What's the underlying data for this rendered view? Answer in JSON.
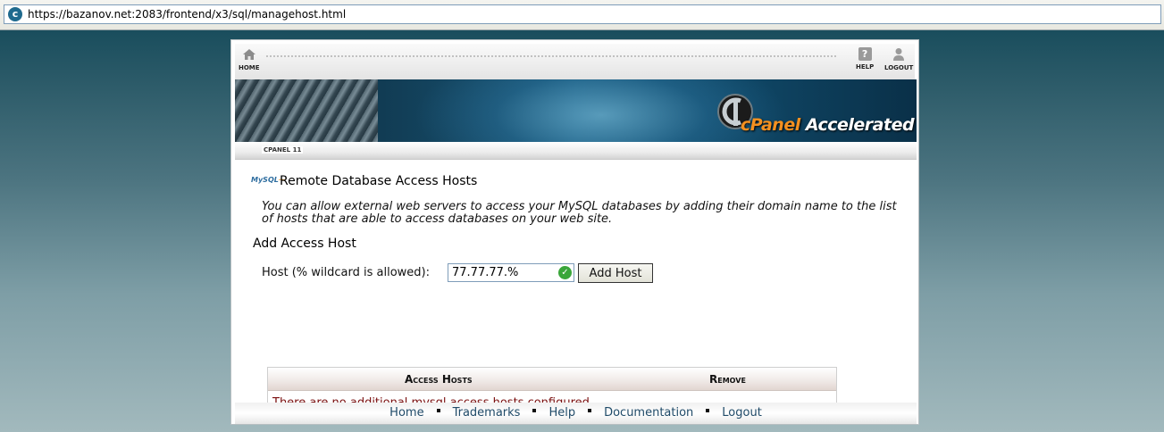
{
  "browser": {
    "url": "https://bazanov.net:2083/frontend/x3/sql/managehost.html"
  },
  "toolbar": {
    "home_label": "HOME",
    "help_label": "HELP",
    "logout_label": "LOGOUT"
  },
  "banner": {
    "brand_primary": "cPanel",
    "brand_secondary": "Accelerated"
  },
  "version_label": "CPANEL 11",
  "page": {
    "icon_text": "MySQL",
    "title": "Remote Database Access Hosts",
    "description": "You can allow external web servers to access your MySQL databases by adding their domain name to the list of hosts that are able to access databases on your web site.",
    "add_section_title": "Add Access Host",
    "host_label": "Host (% wildcard is allowed):",
    "host_value": "77.77.77.%",
    "add_button": "Add Host"
  },
  "hosts_table": {
    "columns": [
      "Access Hosts",
      "Remove"
    ],
    "rows": [],
    "empty_message": "There are no additional mysql access hosts configured"
  },
  "footer": {
    "links": [
      "Home",
      "Trademarks",
      "Help",
      "Documentation",
      "Logout"
    ]
  },
  "colors": {
    "link": "#1f4a68",
    "empty_message": "#7a0f0f",
    "brand_accent": "#f39020"
  }
}
